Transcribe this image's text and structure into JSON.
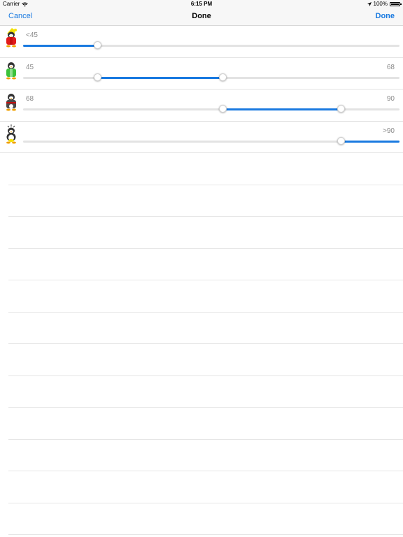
{
  "status_bar": {
    "carrier": "Carrier",
    "time": "6:15 PM",
    "battery": "100%",
    "icons": [
      "wifi-icon",
      "location-arrow-icon",
      "battery-icon"
    ]
  },
  "nav": {
    "cancel": "Cancel",
    "title": "Done",
    "done": "Done"
  },
  "ranges": [
    {
      "avatar": "penguin-red-sweater-hat",
      "low": "<45",
      "high": "",
      "min_pct": 0.0,
      "max_pct": 0.198
    },
    {
      "avatar": "penguin-green-sweater",
      "low": "45",
      "high": "68",
      "min_pct": 0.198,
      "max_pct": 0.53
    },
    {
      "avatar": "penguin-dark-sweater",
      "low": "68",
      "high": "90",
      "min_pct": 0.53,
      "max_pct": 0.845
    },
    {
      "avatar": "penguin-sunny",
      "low": "",
      "high": ">90",
      "min_pct": 0.845,
      "max_pct": 1.0
    }
  ],
  "colors": {
    "accent": "#1a7ae0",
    "track": "#e3e3e3"
  }
}
